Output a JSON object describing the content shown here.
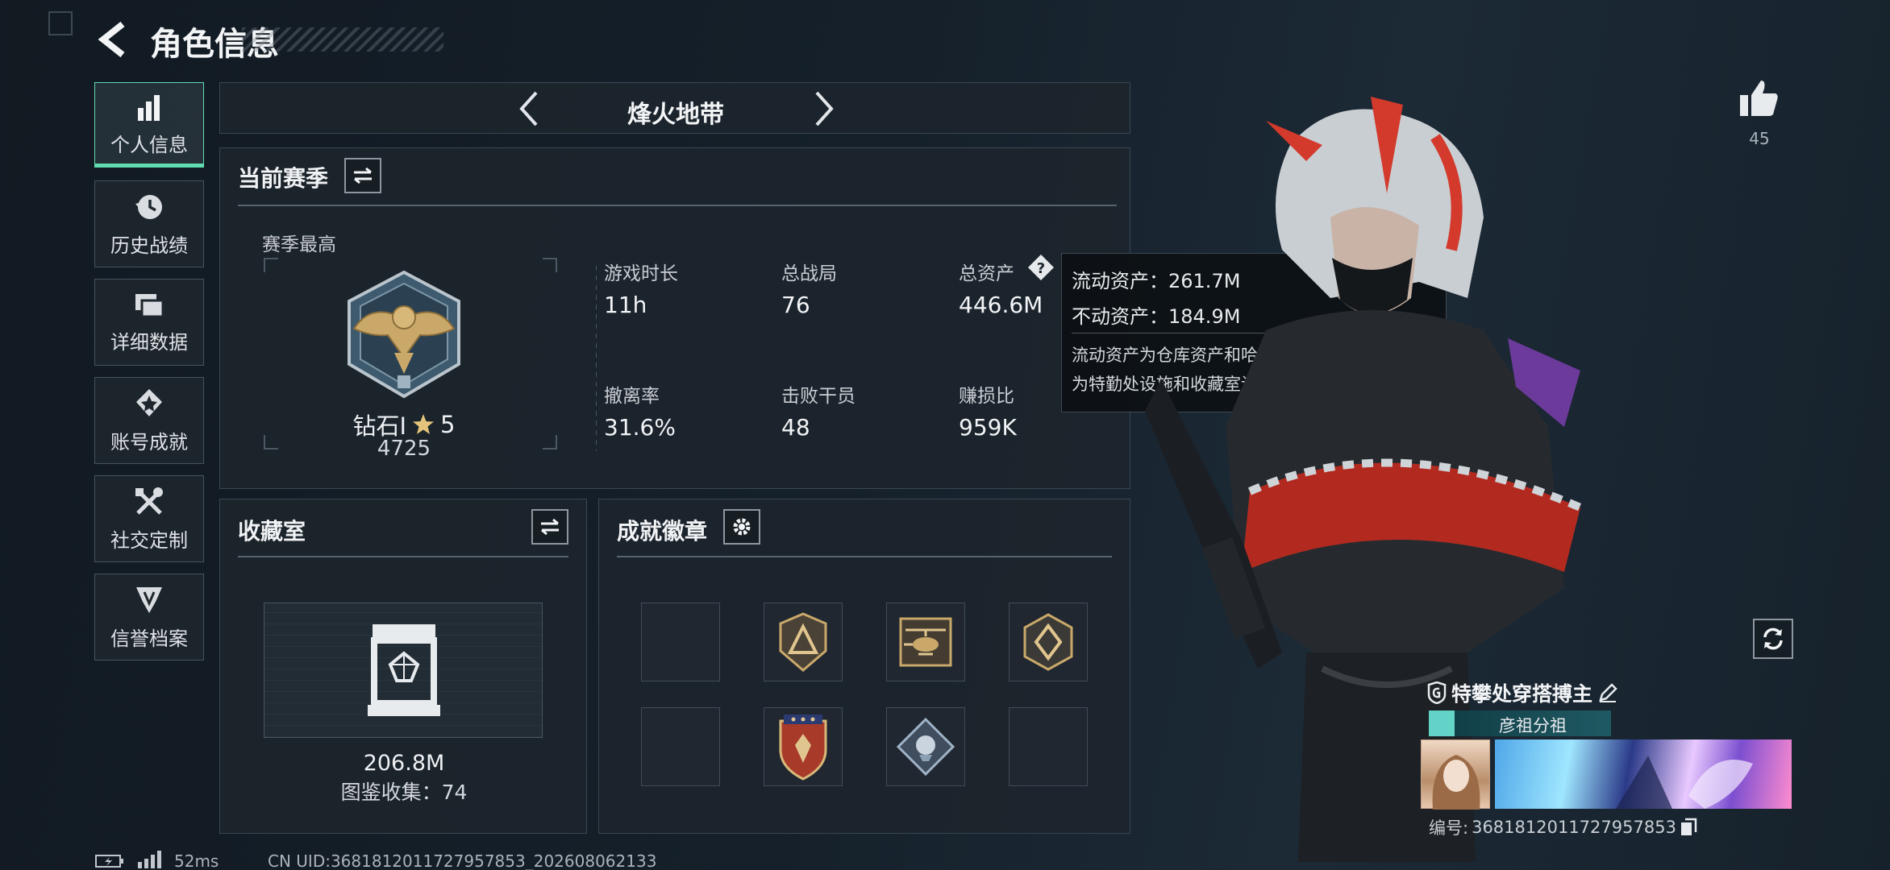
{
  "header": {
    "title": "角色信息"
  },
  "sidebar": {
    "items": [
      {
        "label": "个人信息",
        "icon": "bar-chart-icon",
        "active": true
      },
      {
        "label": "历史战绩",
        "icon": "history-clock-icon"
      },
      {
        "label": "详细数据",
        "icon": "data-cards-icon"
      },
      {
        "label": "账号成就",
        "icon": "achievement-icon"
      },
      {
        "label": "社交定制",
        "icon": "tools-icon"
      },
      {
        "label": "信誉档案",
        "icon": "reputation-icon"
      }
    ]
  },
  "mode_nav": {
    "title": "烽火地带"
  },
  "season": {
    "title": "当前赛季",
    "best_label": "赛季最高",
    "rank_name": "钻石Ⅰ",
    "rank_stars": "5",
    "rank_score": "4725",
    "stats": [
      {
        "label": "游戏时长",
        "value": "11h"
      },
      {
        "label": "总战局",
        "value": "76"
      },
      {
        "label": "总资产",
        "value": "446.6M"
      },
      {
        "label": "撤离率",
        "value": "31.6%"
      },
      {
        "label": "击败干员",
        "value": "48"
      },
      {
        "label": "赚损比",
        "value": "959K"
      }
    ]
  },
  "tooltip": {
    "line1_label": "流动资产：",
    "line1_value": "261.7M",
    "line2_label": "不动资产：",
    "line2_value": "184.9M",
    "desc_line1": "流动资产为仓库资产和哈夫币，不动资产",
    "desc_line2": "为特勤处设施和收藏室设施"
  },
  "collection": {
    "title": "收藏室",
    "value": "206.8M",
    "catalog_label": "图鉴收集：",
    "catalog_count": "74"
  },
  "badges": {
    "title": "成就徽章",
    "slots": [
      {
        "icon": ""
      },
      {
        "icon": "triangle-badge-icon"
      },
      {
        "icon": "helicopter-badge-icon"
      },
      {
        "icon": "hexagon-badge-icon"
      },
      {
        "icon": ""
      },
      {
        "icon": "star-shield-badge-icon"
      },
      {
        "icon": "diamond-badge-icon"
      },
      {
        "icon": ""
      }
    ]
  },
  "profile": {
    "likes": "45",
    "title_text": "特攀处穿搭搏主",
    "clan": "彦祖分祖",
    "id_label": "编号:",
    "id_value": "3681812011727957853"
  },
  "footer": {
    "ping": "52ms",
    "uid": "CN UID:3681812011727957853_202608062133"
  },
  "colors": {
    "accent": "#5fdcb0",
    "panel": "#1c242c",
    "badge_gold": "#c9a86a",
    "clan_bar": "#1f5a63"
  }
}
